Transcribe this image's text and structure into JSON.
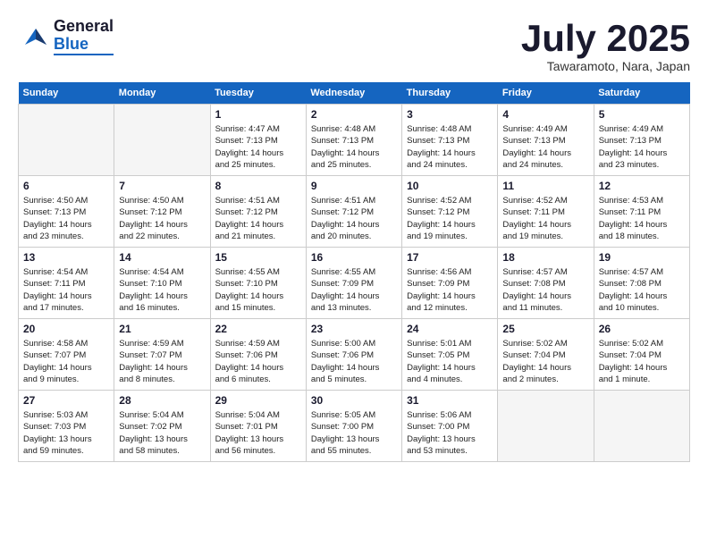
{
  "header": {
    "logo_general": "General",
    "logo_blue": "Blue",
    "month_title": "July 2025",
    "location": "Tawaramoto, Nara, Japan"
  },
  "weekdays": [
    "Sunday",
    "Monday",
    "Tuesday",
    "Wednesday",
    "Thursday",
    "Friday",
    "Saturday"
  ],
  "weeks": [
    [
      {
        "day": "",
        "info": ""
      },
      {
        "day": "",
        "info": ""
      },
      {
        "day": "1",
        "info": "Sunrise: 4:47 AM\nSunset: 7:13 PM\nDaylight: 14 hours\nand 25 minutes."
      },
      {
        "day": "2",
        "info": "Sunrise: 4:48 AM\nSunset: 7:13 PM\nDaylight: 14 hours\nand 25 minutes."
      },
      {
        "day": "3",
        "info": "Sunrise: 4:48 AM\nSunset: 7:13 PM\nDaylight: 14 hours\nand 24 minutes."
      },
      {
        "day": "4",
        "info": "Sunrise: 4:49 AM\nSunset: 7:13 PM\nDaylight: 14 hours\nand 24 minutes."
      },
      {
        "day": "5",
        "info": "Sunrise: 4:49 AM\nSunset: 7:13 PM\nDaylight: 14 hours\nand 23 minutes."
      }
    ],
    [
      {
        "day": "6",
        "info": "Sunrise: 4:50 AM\nSunset: 7:13 PM\nDaylight: 14 hours\nand 23 minutes."
      },
      {
        "day": "7",
        "info": "Sunrise: 4:50 AM\nSunset: 7:12 PM\nDaylight: 14 hours\nand 22 minutes."
      },
      {
        "day": "8",
        "info": "Sunrise: 4:51 AM\nSunset: 7:12 PM\nDaylight: 14 hours\nand 21 minutes."
      },
      {
        "day": "9",
        "info": "Sunrise: 4:51 AM\nSunset: 7:12 PM\nDaylight: 14 hours\nand 20 minutes."
      },
      {
        "day": "10",
        "info": "Sunrise: 4:52 AM\nSunset: 7:12 PM\nDaylight: 14 hours\nand 19 minutes."
      },
      {
        "day": "11",
        "info": "Sunrise: 4:52 AM\nSunset: 7:11 PM\nDaylight: 14 hours\nand 19 minutes."
      },
      {
        "day": "12",
        "info": "Sunrise: 4:53 AM\nSunset: 7:11 PM\nDaylight: 14 hours\nand 18 minutes."
      }
    ],
    [
      {
        "day": "13",
        "info": "Sunrise: 4:54 AM\nSunset: 7:11 PM\nDaylight: 14 hours\nand 17 minutes."
      },
      {
        "day": "14",
        "info": "Sunrise: 4:54 AM\nSunset: 7:10 PM\nDaylight: 14 hours\nand 16 minutes."
      },
      {
        "day": "15",
        "info": "Sunrise: 4:55 AM\nSunset: 7:10 PM\nDaylight: 14 hours\nand 15 minutes."
      },
      {
        "day": "16",
        "info": "Sunrise: 4:55 AM\nSunset: 7:09 PM\nDaylight: 14 hours\nand 13 minutes."
      },
      {
        "day": "17",
        "info": "Sunrise: 4:56 AM\nSunset: 7:09 PM\nDaylight: 14 hours\nand 12 minutes."
      },
      {
        "day": "18",
        "info": "Sunrise: 4:57 AM\nSunset: 7:08 PM\nDaylight: 14 hours\nand 11 minutes."
      },
      {
        "day": "19",
        "info": "Sunrise: 4:57 AM\nSunset: 7:08 PM\nDaylight: 14 hours\nand 10 minutes."
      }
    ],
    [
      {
        "day": "20",
        "info": "Sunrise: 4:58 AM\nSunset: 7:07 PM\nDaylight: 14 hours\nand 9 minutes."
      },
      {
        "day": "21",
        "info": "Sunrise: 4:59 AM\nSunset: 7:07 PM\nDaylight: 14 hours\nand 8 minutes."
      },
      {
        "day": "22",
        "info": "Sunrise: 4:59 AM\nSunset: 7:06 PM\nDaylight: 14 hours\nand 6 minutes."
      },
      {
        "day": "23",
        "info": "Sunrise: 5:00 AM\nSunset: 7:06 PM\nDaylight: 14 hours\nand 5 minutes."
      },
      {
        "day": "24",
        "info": "Sunrise: 5:01 AM\nSunset: 7:05 PM\nDaylight: 14 hours\nand 4 minutes."
      },
      {
        "day": "25",
        "info": "Sunrise: 5:02 AM\nSunset: 7:04 PM\nDaylight: 14 hours\nand 2 minutes."
      },
      {
        "day": "26",
        "info": "Sunrise: 5:02 AM\nSunset: 7:04 PM\nDaylight: 14 hours\nand 1 minute."
      }
    ],
    [
      {
        "day": "27",
        "info": "Sunrise: 5:03 AM\nSunset: 7:03 PM\nDaylight: 13 hours\nand 59 minutes."
      },
      {
        "day": "28",
        "info": "Sunrise: 5:04 AM\nSunset: 7:02 PM\nDaylight: 13 hours\nand 58 minutes."
      },
      {
        "day": "29",
        "info": "Sunrise: 5:04 AM\nSunset: 7:01 PM\nDaylight: 13 hours\nand 56 minutes."
      },
      {
        "day": "30",
        "info": "Sunrise: 5:05 AM\nSunset: 7:00 PM\nDaylight: 13 hours\nand 55 minutes."
      },
      {
        "day": "31",
        "info": "Sunrise: 5:06 AM\nSunset: 7:00 PM\nDaylight: 13 hours\nand 53 minutes."
      },
      {
        "day": "",
        "info": ""
      },
      {
        "day": "",
        "info": ""
      }
    ]
  ]
}
